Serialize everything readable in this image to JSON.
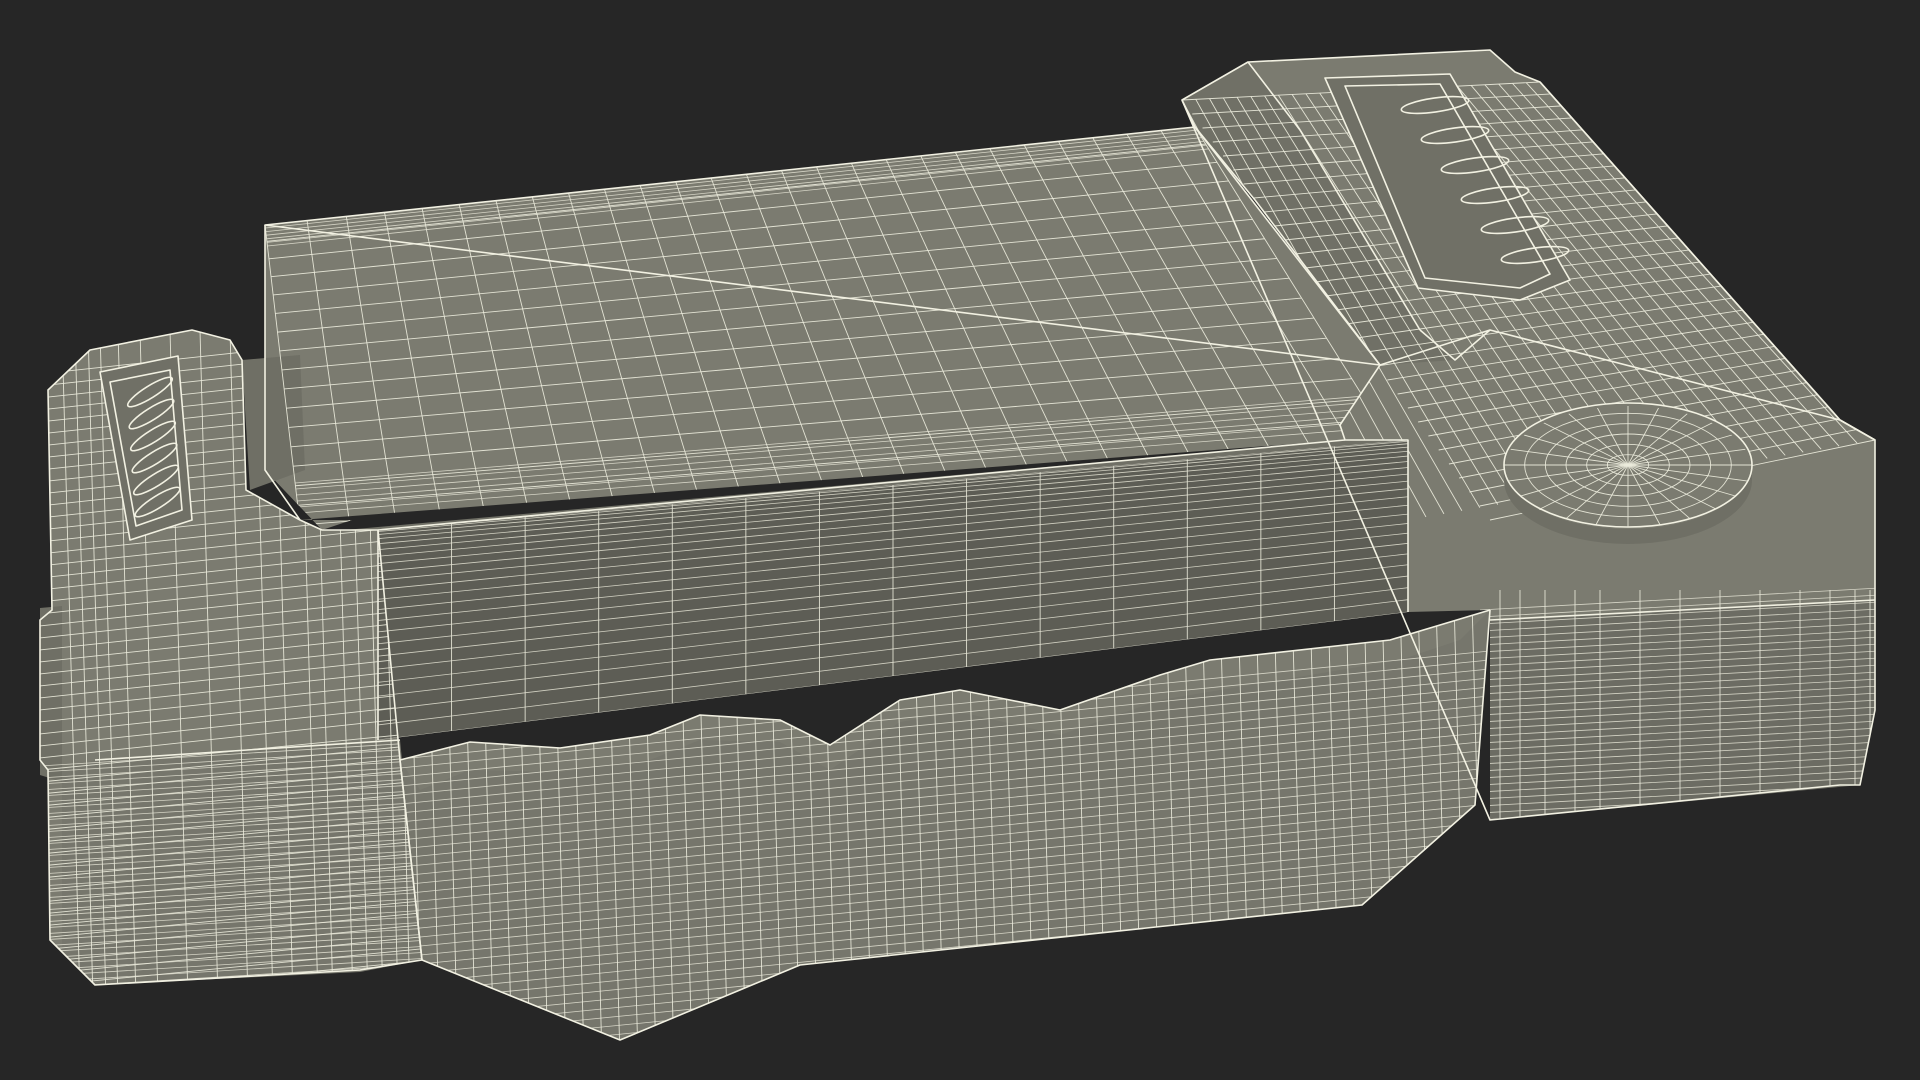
{
  "scene": {
    "subject": "wireframe-3d-model",
    "colors": {
      "background": "#262626",
      "surface": "#7b7b70",
      "wireframe": "#ecebdc"
    }
  }
}
